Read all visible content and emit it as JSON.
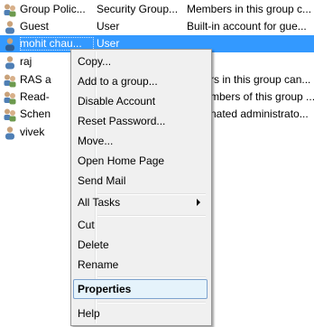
{
  "rows": [
    {
      "name": "Group Polic...",
      "type": "Security Group...",
      "desc": "Members in this group c...",
      "icon": "group-icon"
    },
    {
      "name": "Guest",
      "type": "User",
      "desc": "Built-in account for gue...",
      "icon": "user-icon"
    },
    {
      "name": "mohit chau...",
      "type": "User",
      "desc": "",
      "icon": "user-icon"
    },
    {
      "name": "raj",
      "type": "",
      "desc": "",
      "icon": "user-icon"
    },
    {
      "name": "RAS a",
      "type": "",
      "desc": "rs in this group can...",
      "icon": "group-icon"
    },
    {
      "name": "Read-",
      "type": "",
      "desc": "mbers of this group ...",
      "icon": "group-icon"
    },
    {
      "name": "Schen",
      "type": "",
      "desc": "nated administrato...",
      "icon": "group-icon"
    },
    {
      "name": "vivek",
      "type": "",
      "desc": "",
      "icon": "user-icon"
    }
  ],
  "menu": {
    "items": [
      {
        "label": "Copy..."
      },
      {
        "label": "Add to a group..."
      },
      {
        "label": "Disable Account"
      },
      {
        "label": "Reset Password..."
      },
      {
        "label": "Move..."
      },
      {
        "label": "Open Home Page"
      },
      {
        "label": "Send Mail"
      },
      {
        "label": "All Tasks",
        "submenu": true
      },
      {
        "label": "Cut"
      },
      {
        "label": "Delete"
      },
      {
        "label": "Rename"
      },
      {
        "label": "Properties",
        "highlighted": true
      },
      {
        "label": "Help"
      }
    ]
  },
  "colors": {
    "selection": "#3399ff",
    "menu_bg": "#f0f0f0",
    "highlight_bg": "#e5f3fb",
    "highlight_border": "#7da2ce"
  }
}
